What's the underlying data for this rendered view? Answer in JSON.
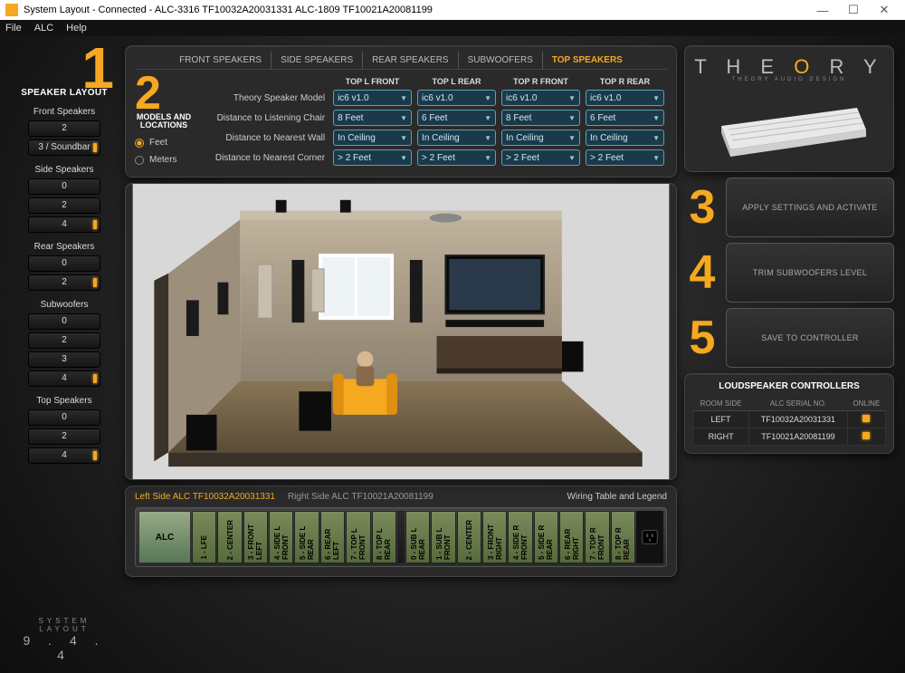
{
  "window": {
    "title": "System Layout - Connected - ALC-3316 TF10032A20031331   ALC-1809 TF10021A20081199"
  },
  "menu": {
    "file": "File",
    "alc": "ALC",
    "help": "Help"
  },
  "step1": {
    "num": "1",
    "title": "SPEAKER LAYOUT",
    "groups": [
      {
        "label": "Front Speakers",
        "options": [
          "2",
          "3 / Soundbar"
        ],
        "selected": 1
      },
      {
        "label": "Side Speakers",
        "options": [
          "0",
          "2",
          "4"
        ],
        "selected": 2
      },
      {
        "label": "Rear Speakers",
        "options": [
          "0",
          "2"
        ],
        "selected": 1
      },
      {
        "label": "Subwoofers",
        "options": [
          "0",
          "2",
          "3",
          "4"
        ],
        "selected": 3
      },
      {
        "label": "Top Speakers",
        "options": [
          "0",
          "2",
          "4"
        ],
        "selected": 2
      }
    ],
    "layout_label": "SYSTEM LAYOUT",
    "layout_value": "9 . 4 . 4"
  },
  "step2": {
    "num": "2",
    "title": "MODELS AND LOCATIONS",
    "units": {
      "feet": "Feet",
      "meters": "Meters",
      "selected": "feet"
    },
    "tabs": [
      "FRONT SPEAKERS",
      "SIDE SPEAKERS",
      "REAR SPEAKERS",
      "SUBWOOFERS",
      "TOP SPEAKERS"
    ],
    "active_tab": 4,
    "columns": [
      "TOP L FRONT",
      "TOP L REAR",
      "TOP R FRONT",
      "TOP R REAR"
    ],
    "rows": [
      {
        "label": "Theory Speaker Model",
        "values": [
          "ic6 v1.0",
          "ic6 v1.0",
          "ic6 v1.0",
          "ic6 v1.0"
        ]
      },
      {
        "label": "Distance to Listening Chair",
        "values": [
          "8 Feet",
          "6 Feet",
          "8 Feet",
          "6 Feet"
        ]
      },
      {
        "label": "Distance to Nearest Wall",
        "values": [
          "In Ceiling",
          "In Ceiling",
          "In Ceiling",
          "In Ceiling"
        ]
      },
      {
        "label": "Distance to Nearest Corner",
        "values": [
          "> 2 Feet",
          "> 2 Feet",
          "> 2 Feet",
          "> 2 Feet"
        ]
      }
    ]
  },
  "strip": {
    "left_label": "Left Side ALC  TF10032A20031331",
    "right_label": "Right Side ALC  TF10021A20081199",
    "wiring": "Wiring Table and Legend",
    "alc_plate": "ALC",
    "channels_left": [
      "1 - LFE",
      "2 - CENTER",
      "3 - FRONT LEFT",
      "4 - SIDE L FRONT",
      "5 - SIDE L REAR",
      "6 - REAR LEFT",
      "7 - TOP L FRONT",
      "8 - TOP L REAR"
    ],
    "channels_right": [
      "0 - SUB L REAR",
      "1 - SUB L FRONT",
      "2 - CENTER",
      "3 - FRONT RIGHT",
      "4 - SIDE R FRONT",
      "5 - SIDE R REAR",
      "6 - REAR RIGHT",
      "7 - TOP R FRONT",
      "8 - TOP R REAR"
    ]
  },
  "logo": {
    "brand": "THEORY",
    "sub": "THEORY AUDIO DESIGN"
  },
  "actions": {
    "a3": {
      "num": "3",
      "label": "APPLY SETTINGS AND ACTIVATE"
    },
    "a4": {
      "num": "4",
      "label": "TRIM SUBWOOFERS LEVEL"
    },
    "a5": {
      "num": "5",
      "label": "SAVE TO CONTROLLER"
    }
  },
  "lsc": {
    "title": "LOUDSPEAKER CONTROLLERS",
    "headers": [
      "ROOM SIDE",
      "ALC SERIAL NO.",
      "ONLINE"
    ],
    "rows": [
      {
        "side": "LEFT",
        "serial": "TF10032A20031331",
        "online": true
      },
      {
        "side": "RIGHT",
        "serial": "TF10021A20081199",
        "online": true
      }
    ]
  }
}
